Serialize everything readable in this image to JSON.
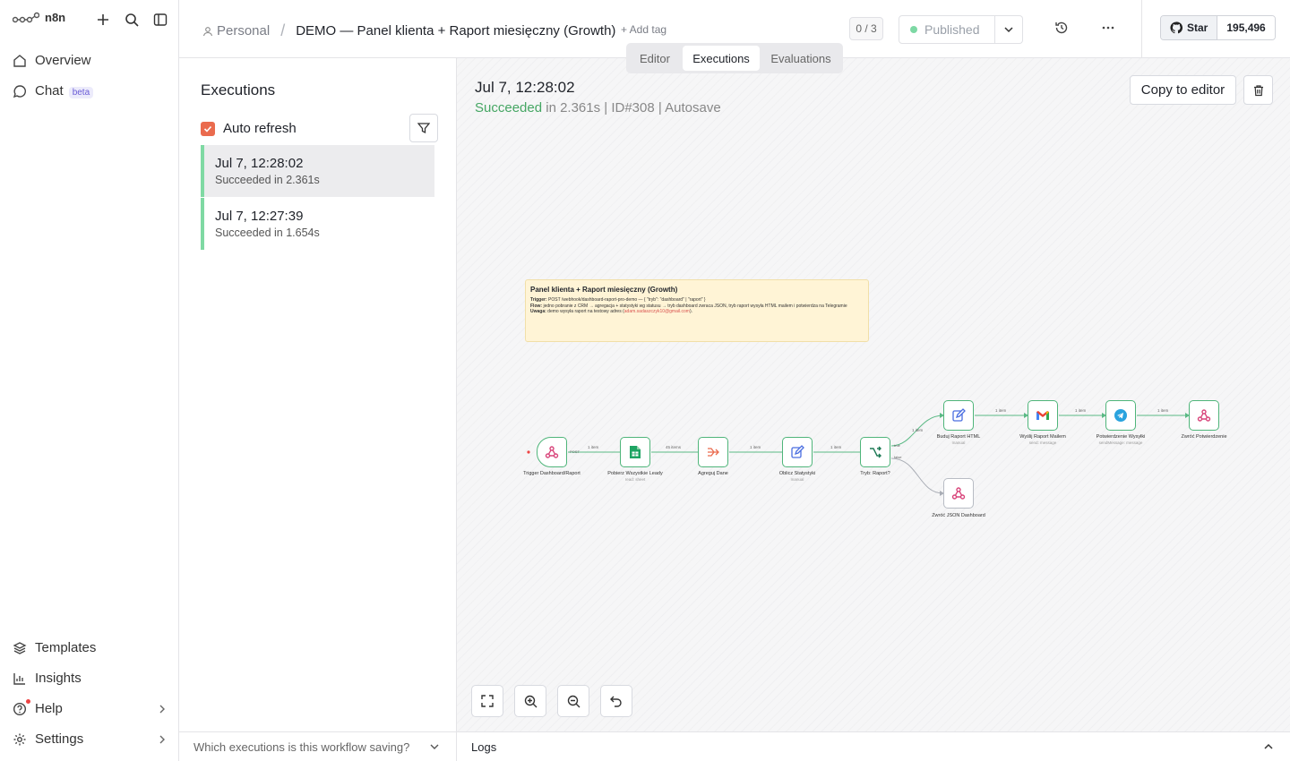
{
  "app": {
    "name": "n8n"
  },
  "sidebar": {
    "items_top": [
      {
        "label": "Overview",
        "icon": "home-icon"
      },
      {
        "label": "Chat",
        "icon": "chat-icon",
        "badge": "beta"
      }
    ],
    "items_bottom": [
      {
        "label": "Templates",
        "icon": "templates-icon"
      },
      {
        "label": "Insights",
        "icon": "insights-icon"
      },
      {
        "label": "Help",
        "icon": "help-icon"
      },
      {
        "label": "Settings",
        "icon": "gear-icon"
      }
    ]
  },
  "header": {
    "project": "Personal",
    "workflow_title": "DEMO — Panel klienta + Raport miesięczny (Growth)",
    "add_tag": "+ Add tag",
    "count": "0 / 3",
    "status": "Published",
    "github": {
      "star": "Star",
      "count": "195,496"
    },
    "tabs": [
      "Editor",
      "Executions",
      "Evaluations"
    ],
    "active_tab": "Executions"
  },
  "executions": {
    "title": "Executions",
    "auto_refresh": "Auto refresh",
    "auto_refresh_checked": true,
    "items": [
      {
        "date": "Jul 7, 12:28:02",
        "status": "Succeeded in 2.361s"
      },
      {
        "date": "Jul 7, 12:27:39",
        "status": "Succeeded in 1.654s"
      }
    ],
    "footer": "Which executions is this workflow saving?"
  },
  "run": {
    "date": "Jul 7, 12:28:02",
    "status": "Succeeded",
    "meta": " in 2.361s | ID#308 | Autosave",
    "copy_button": "Copy to editor"
  },
  "note": {
    "title": "Panel klienta + Raport miesięczny (Growth)",
    "trigger_label": "Trigger:",
    "trigger_text": " POST /webhook/dashboard-raport-pro-demo — { \"tryb\": \"dashboard\" | \"raport\" }",
    "flow_label": "Flow:",
    "flow_text": " jedno pobranie z CRM → agregacja + statystyki wg statusu → tryb dashboard zwraca JSON, tryb raport wysyła HTML mailem i potwierdza na Telegramie",
    "warn_label": "Uwaga:",
    "warn_text": " demo wysyła raport na testowy adres (",
    "warn_email": "adam.sadaszczyk10@gmail.com",
    "warn_end": ")."
  },
  "nodes": [
    {
      "label": "Trigger Dashboard/Raport",
      "sub": "",
      "icon": "webhook-icon"
    },
    {
      "label": "Pobierz Wszystkie Leady",
      "sub": "read: sheet",
      "icon": "sheets-icon"
    },
    {
      "label": "Agreguj Dane",
      "sub": "",
      "icon": "aggregate-icon"
    },
    {
      "label": "Oblicz Statystyki",
      "sub": "manual",
      "icon": "edit-icon"
    },
    {
      "label": "Tryb: Raport?",
      "sub": "",
      "icon": "if-icon"
    },
    {
      "label": "Buduj Raport HTML",
      "sub": "manual",
      "icon": "edit-icon"
    },
    {
      "label": "Wyślij Raport Mailem",
      "sub": "send: message",
      "icon": "gmail-icon"
    },
    {
      "label": "Potwierdzenie Wysyłki",
      "sub": "sendMessage: message",
      "icon": "telegram-icon"
    },
    {
      "label": "Zwróć Potwierdzenie",
      "sub": "",
      "icon": "webhook-icon"
    },
    {
      "label": "Zwróć JSON Dashboard",
      "sub": "",
      "icon": "webhook-icon"
    }
  ],
  "edge_labels": {
    "e1": "1 item",
    "e2": "45 items",
    "e3": "1 item",
    "e4": "1 item",
    "e5": "1 item",
    "e6": "1 item",
    "e7": "1 item",
    "e8": "1 item",
    "post": "POST",
    "true": "true",
    "false": "false"
  },
  "logs": {
    "title": "Logs"
  },
  "colors": {
    "accent": "#ea6b4e",
    "success": "#45a663",
    "node_border": "#4fb57a"
  }
}
